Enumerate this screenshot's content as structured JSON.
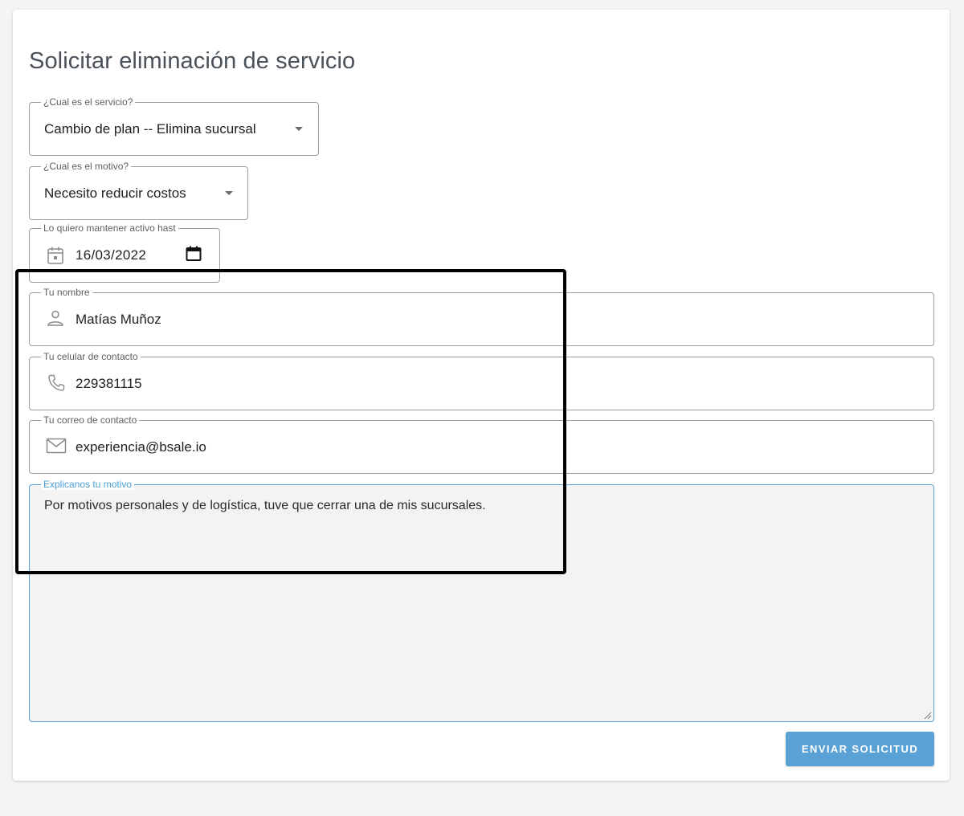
{
  "form": {
    "title": "Solicitar eliminación de servicio",
    "service": {
      "label": "¿Cual es el servicio?",
      "value": "Cambio de plan -- Elimina sucursal"
    },
    "reason": {
      "label": "¿Cual es el motivo?",
      "value": "Necesito reducir costos"
    },
    "active_until": {
      "label": "Lo quiero mantener activo hast",
      "value": "16/03/2022"
    },
    "name": {
      "label": "Tu nombre",
      "value": "Matías Muñoz"
    },
    "phone": {
      "label": "Tu celular de contacto",
      "value": "229381115"
    },
    "email": {
      "label": "Tu correo de contacto",
      "value": "experiencia@bsale.io"
    },
    "explanation": {
      "label": "Explicanos tu motivo",
      "value": "Por motivos personales y de logística, tuve que cerrar una de mis sucursales."
    },
    "submit_label": "ENVIAR SOLICITUD"
  },
  "icons": {
    "active_until": "calendar-icon",
    "date_picker": "calendar-picker-icon",
    "name": "person-icon",
    "phone": "phone-icon",
    "email": "mail-icon",
    "dropdown": "dropdown-arrow-icon"
  },
  "colors": {
    "accent": "#5aa2d6",
    "focus_border": "#5aa2d6",
    "annotation_box": "#000000"
  }
}
